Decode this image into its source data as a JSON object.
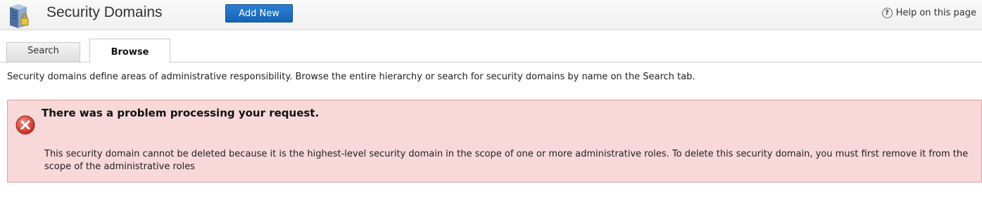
{
  "header": {
    "title": "Security Domains",
    "add_new_label": "Add New",
    "help_label": "Help on this page",
    "help_icon_glyph": "?"
  },
  "tabs": [
    {
      "label": "Search",
      "active": false
    },
    {
      "label": "Browse",
      "active": true
    }
  ],
  "description": "Security domains define areas of administrative responsibility. Browse the entire hierarchy or search for security domains by name on the Search tab.",
  "error": {
    "title": "There was a problem processing your request.",
    "message": "This security domain cannot be deleted because it is the highest-level security domain in the scope of one or more administrative roles. To delete this security domain, you must first remove it from the scope of the administrative roles"
  },
  "colors": {
    "accent_button": "#1463b6",
    "error_background": "#f8d8d8",
    "error_border": "#e0a0a0",
    "error_icon": "#d23b2e"
  },
  "icons": {
    "page_icon": "server-lock-icon",
    "help_icon": "help-icon",
    "error_icon": "error-x-icon"
  }
}
